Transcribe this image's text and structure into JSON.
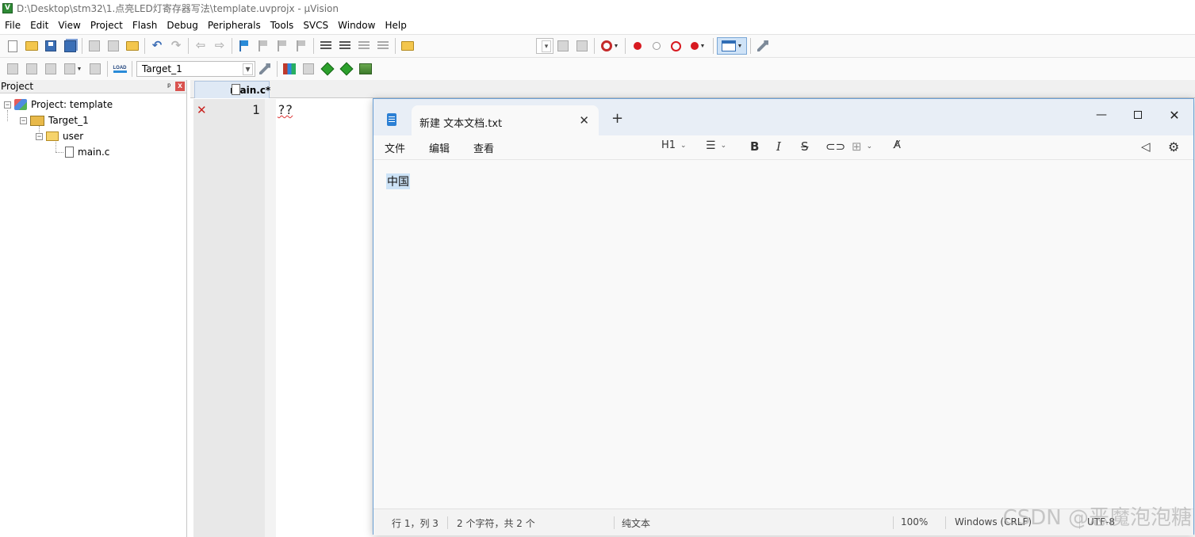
{
  "uvision": {
    "title": "D:\\Desktop\\stm32\\1.点亮LED灯寄存器写法\\template.uvprojx - µVision",
    "app_icon": "V",
    "menu": [
      "File",
      "Edit",
      "View",
      "Project",
      "Flash",
      "Debug",
      "Peripherals",
      "Tools",
      "SVCS",
      "Window",
      "Help"
    ],
    "toolbar": {
      "target_select": "Target_1",
      "load_label": "LOAD"
    },
    "project_panel": {
      "title": "Project",
      "pin": "ㅁ",
      "close": "x",
      "tree": {
        "project": "Project: template",
        "target": "Target_1",
        "group": "user",
        "file": "main.c"
      }
    },
    "editor": {
      "tab": "main.c*",
      "line_number": "1",
      "code": "??",
      "error_marker": "✕"
    },
    "colors": {
      "error": "#c9211e",
      "active_tab": "#dfe9f5"
    }
  },
  "notepad": {
    "tab_title": "新建 文本文档.txt",
    "tab_close": "✕",
    "new_tab": "+",
    "window_controls": {
      "minimize": "—",
      "close": "✕"
    },
    "menu": [
      "文件",
      "编辑",
      "查看"
    ],
    "format": {
      "heading": "H1"
    },
    "content": "中国",
    "status": {
      "position": "行 1，列 3",
      "chars": "2 个字符，共 2 个",
      "format": "纯文本",
      "zoom": "100%",
      "line_ending": "Windows (CRLF)",
      "encoding": "UTF-8"
    },
    "icons": [
      "notepad-icon",
      "bullet-list-icon",
      "bold-icon",
      "italic-icon",
      "strikethrough-icon",
      "link-icon",
      "table-icon",
      "clear-format-icon",
      "megaphone-icon",
      "settings-icon"
    ]
  },
  "watermark": "CSDN @恶魔泡泡糖"
}
